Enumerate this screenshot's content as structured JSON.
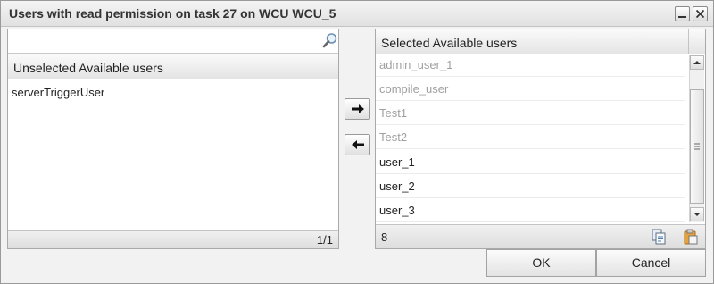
{
  "dialog": {
    "title": "Users with read permission on task 27 on WCU WCU_5"
  },
  "left": {
    "search": {
      "value": "",
      "placeholder": ""
    },
    "header": "Unselected Available users",
    "items": [
      "serverTriggerUser"
    ],
    "page_indicator": "1/1"
  },
  "right": {
    "header": "Selected Available users",
    "items": [
      {
        "label": "admin_user_1",
        "enabled": false
      },
      {
        "label": "compile_user",
        "enabled": false
      },
      {
        "label": "Test1",
        "enabled": false
      },
      {
        "label": "Test2",
        "enabled": false
      },
      {
        "label": "user_1",
        "enabled": true
      },
      {
        "label": "user_2",
        "enabled": true
      },
      {
        "label": "user_3",
        "enabled": true
      }
    ],
    "count": "8"
  },
  "buttons": {
    "ok": "OK",
    "cancel": "Cancel"
  },
  "icons": {
    "minimize": "minimize-icon",
    "close": "close-icon",
    "search": "magnifier-icon",
    "move_right": "arrow-right-icon",
    "move_left": "arrow-left-icon",
    "copy": "copy-icon",
    "paste": "clipboard-icon"
  }
}
